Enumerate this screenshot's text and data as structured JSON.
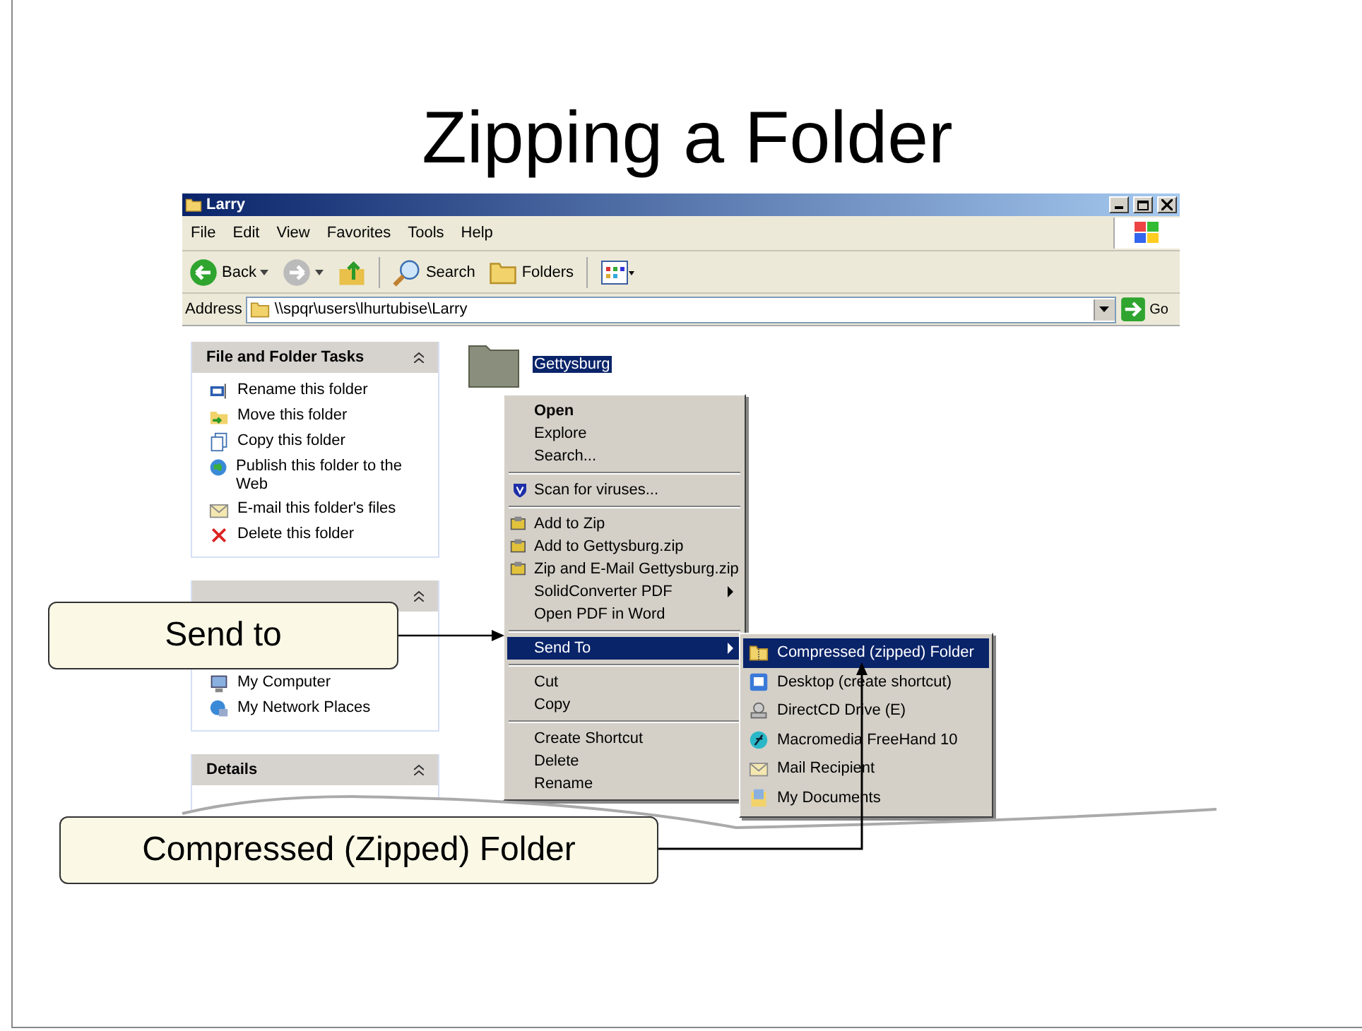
{
  "slide": {
    "title": "Zipping a Folder"
  },
  "window": {
    "title": "Larry"
  },
  "menu_bar": [
    "File",
    "Edit",
    "View",
    "Favorites",
    "Tools",
    "Help"
  ],
  "toolbar": [
    {
      "kind": "back",
      "label": "Back"
    },
    {
      "kind": "forward"
    },
    {
      "kind": "up"
    },
    {
      "kind": "search",
      "label": "Search"
    },
    {
      "kind": "folders",
      "label": "Folders"
    },
    {
      "kind": "views"
    }
  ],
  "address": {
    "label": "Address",
    "value": "\\\\spqr\\users\\lhurtubise\\Larry",
    "go": "Go"
  },
  "task_panes": [
    {
      "title": "File and Folder Tasks",
      "expanded": true,
      "items": [
        {
          "kind": "rename",
          "label": "Rename this folder"
        },
        {
          "kind": "move",
          "label": "Move this folder"
        },
        {
          "kind": "copy",
          "label": "Copy this folder"
        },
        {
          "kind": "globe",
          "label": "Publish this folder to the Web"
        },
        {
          "kind": "mail",
          "label": "E-mail this folder's files"
        },
        {
          "kind": "delete",
          "label": "Delete this folder"
        }
      ]
    },
    {
      "expanded": true,
      "items": [
        {
          "kind": "computer",
          "label": "My Computer"
        },
        {
          "kind": "network",
          "label": "My Network Places"
        }
      ]
    },
    {
      "title": "Details",
      "expanded": true
    }
  ],
  "folder": {
    "name": "Gettysburg",
    "selected": true
  },
  "context_menu": [
    [
      {
        "label": "Open",
        "bold": true
      },
      {
        "label": "Explore"
      },
      {
        "label": "Search..."
      }
    ],
    [
      {
        "label": "Scan for viruses...",
        "kind": "shield"
      }
    ],
    [
      {
        "label": "Add to Zip",
        "kind": "zip"
      },
      {
        "label": "Add to Gettysburg.zip",
        "kind": "zip"
      },
      {
        "label": "Zip and E-Mail Gettysburg.zip",
        "kind": "zip"
      },
      {
        "label": "SolidConverter PDF",
        "submenu": true
      },
      {
        "label": "Open PDF in Word"
      }
    ],
    [
      {
        "label": "Send To",
        "submenu": true,
        "selected": true
      }
    ],
    [
      {
        "label": "Cut"
      },
      {
        "label": "Copy"
      }
    ],
    [
      {
        "label": "Create Shortcut"
      },
      {
        "label": "Delete"
      },
      {
        "label": "Rename"
      }
    ]
  ],
  "send_to_menu": [
    {
      "label": "Compressed (zipped) Folder",
      "kind": "zipfolder",
      "selected": true
    },
    {
      "label": "Desktop (create shortcut)",
      "kind": "desktop",
      "selected": false
    },
    {
      "label": "DirectCD Drive (E)",
      "kind": "drive",
      "selected": false
    },
    {
      "label": "Macromedia FreeHand 10",
      "kind": "freehand",
      "selected": false
    },
    {
      "label": "Mail Recipient",
      "kind": "mail",
      "selected": false
    },
    {
      "label": "My Documents",
      "kind": "documents",
      "selected": false
    }
  ],
  "callouts": [
    {
      "text": "Send to"
    },
    {
      "text": "Compressed (Zipped) Folder"
    }
  ]
}
